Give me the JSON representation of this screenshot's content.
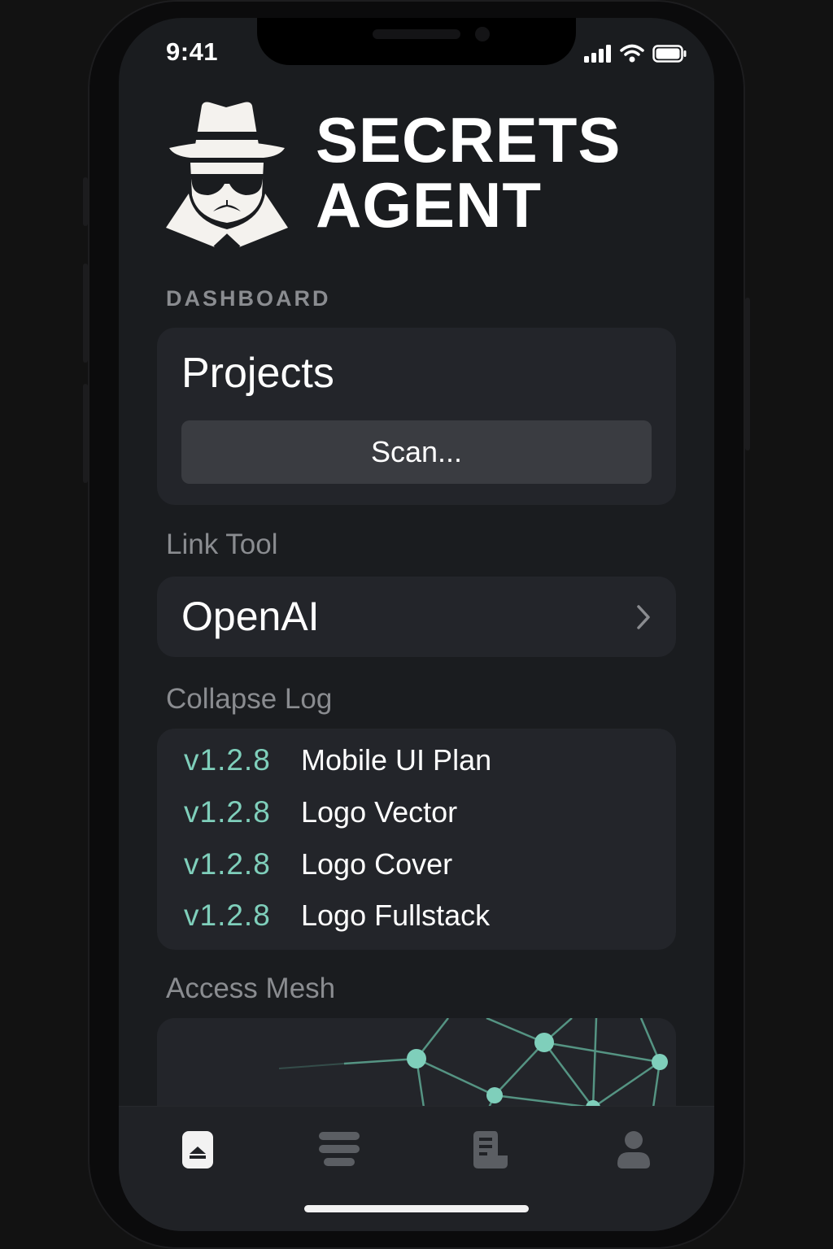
{
  "status_bar": {
    "time": "9:41",
    "signal_icon": "cellular-signal-icon",
    "wifi_icon": "wifi-icon",
    "battery_icon": "battery-icon"
  },
  "header": {
    "logo_icon": "spy-agent-logo-icon",
    "brand_line1": "SECRETS",
    "brand_line2": "AGENT"
  },
  "dashboard": {
    "label": "DASHBOARD",
    "projects_title": "Projects",
    "scan_button": "Scan..."
  },
  "link_tool": {
    "label": "Link Tool",
    "item_label": "OpenAI",
    "chevron_icon": "chevron-right-icon"
  },
  "collapse_log": {
    "label": "Collapse Log",
    "entries": [
      {
        "version": "v1.2.8",
        "name": "Mobile UI Plan"
      },
      {
        "version": "v1.2.8",
        "name": "Logo Vector"
      },
      {
        "version": "v1.2.8",
        "name": "Logo Cover"
      },
      {
        "version": "v1.2.8",
        "name": "Logo Fullstack"
      }
    ]
  },
  "access_mesh": {
    "label": "Access Mesh",
    "graphic": "network-mesh-graphic"
  },
  "tab_bar": {
    "tabs": [
      {
        "icon": "home-icon",
        "active": true
      },
      {
        "icon": "list-icon",
        "active": false
      },
      {
        "icon": "document-icon",
        "active": false
      },
      {
        "icon": "profile-icon",
        "active": false
      }
    ]
  },
  "colors": {
    "accent": "#7fcfbb",
    "background": "#1a1c1f",
    "card": "#23252a",
    "muted_text": "#8a8c90"
  }
}
